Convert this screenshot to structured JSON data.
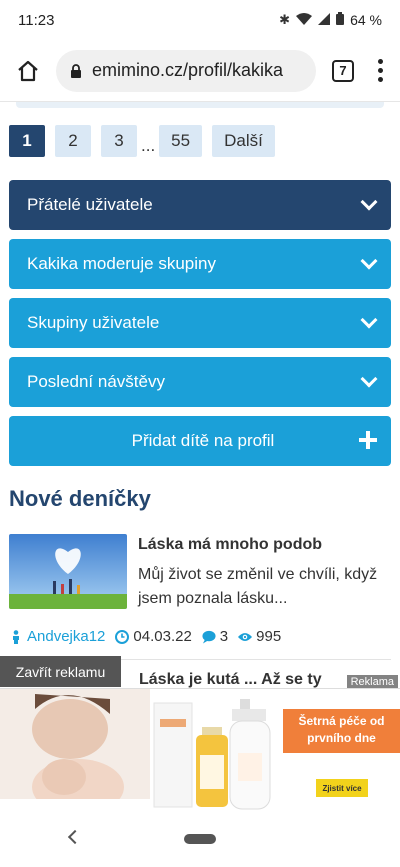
{
  "status_bar": {
    "time": "11:23",
    "battery": "64 %"
  },
  "browser": {
    "url": "emimino.cz/profil/kakika",
    "tab_count": "7"
  },
  "pagination": {
    "pages": [
      "1",
      "2",
      "3"
    ],
    "ellipsis": "...",
    "last_page": "55",
    "next_label": "Další",
    "active_page": "1"
  },
  "accordions": [
    {
      "label": "Přátelé uživatele"
    },
    {
      "label": "Kakika moderuje skupiny"
    },
    {
      "label": "Skupiny uživatele"
    },
    {
      "label": "Poslední návštěvy"
    }
  ],
  "add_child_label": "Přidat dítě na profil",
  "section_title": "Nové deníčky",
  "diary": {
    "title": "Láska má mnoho podob",
    "excerpt": "Můj život se změnil ve chvíli, když jsem poznala lásku...",
    "author": "Andvejka12",
    "date": "04.03.22",
    "comments": "3",
    "views": "995"
  },
  "next_diary_partial": "Láska je kutá ... Až se ty",
  "ad": {
    "close_label": "Zavřít reklamu",
    "label": "Reklama",
    "banner_text": "Šetrná péče od prvního dne",
    "cta": "Zjistit více"
  },
  "colors": {
    "dark_blue": "#24466f",
    "light_blue": "#1ba0d8",
    "page_bg": "#dae8f5",
    "ad_orange": "#f07f3a"
  }
}
